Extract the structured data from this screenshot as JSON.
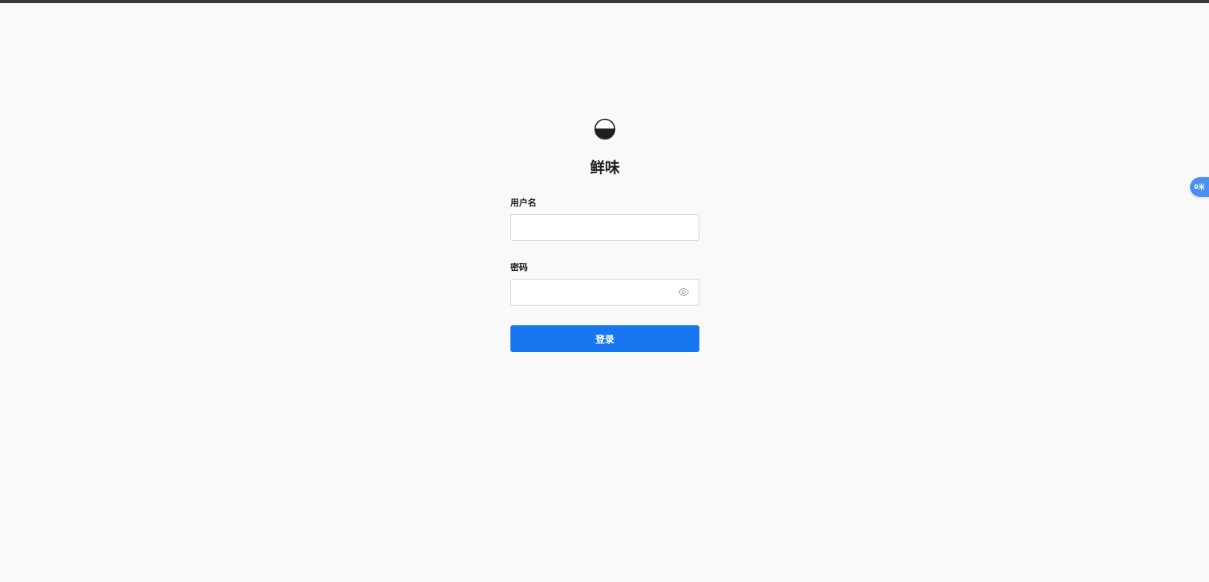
{
  "brand": {
    "name": "鲜味",
    "logo_icon": "bowl-icon"
  },
  "form": {
    "username_label": "用户名",
    "username_value": "",
    "password_label": "密码",
    "password_value": "",
    "password_toggle_icon": "eye-icon",
    "submit_label": "登录"
  },
  "floating_badge": {
    "text": "0米"
  },
  "colors": {
    "background": "#f9f9f9",
    "top_bar": "#3a3a3a",
    "primary": "#1677f0",
    "badge": "#4a90f0",
    "text": "#1f1f1f"
  }
}
